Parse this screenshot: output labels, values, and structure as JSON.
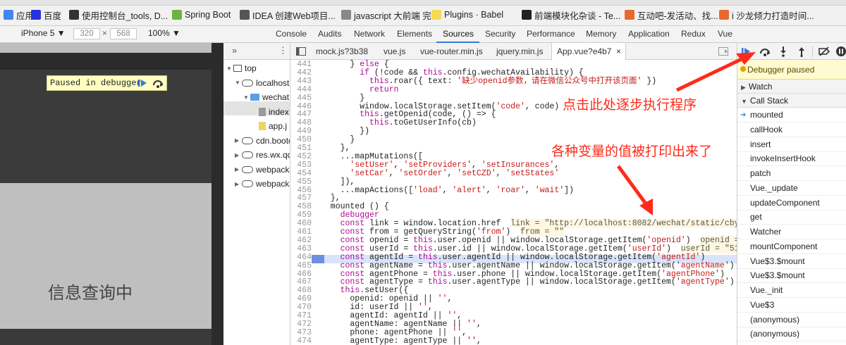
{
  "bookmarks": [
    {
      "label": "应用",
      "icon": "apps-grid-icon",
      "color": "#4285f4"
    },
    {
      "label": "百度",
      "icon": "baidu-paw-icon",
      "color": "#2932e1"
    },
    {
      "label": "使用控制台_tools, D...",
      "icon": "site-icon",
      "color": "#333333"
    },
    {
      "label": "Spring Boot",
      "icon": "spring-leaf-icon",
      "color": "#6db33f"
    },
    {
      "label": "IDEA 创建Web项目...",
      "icon": "idea-icon",
      "color": "#555555"
    },
    {
      "label": "javascript 大前端 完...",
      "icon": "page-icon",
      "color": "#888888"
    },
    {
      "label": "Plugins · Babel",
      "icon": "babel-icon",
      "color": "#f5da55"
    },
    {
      "label": "前端模块化杂谈 - Te...",
      "icon": "t-logo-icon",
      "color": "#222222"
    },
    {
      "label": "互动吧-发活动、找...",
      "icon": "hudongba-icon",
      "color": "#e8692e"
    },
    {
      "label": "i 沙龙倾力打造时间...",
      "icon": "salon-icon",
      "color": "#e8692e"
    }
  ],
  "device_toolbar": {
    "device": "iPhone 5 ▼",
    "width": "320",
    "times": "×",
    "height": "568",
    "zoom": "100% ▼"
  },
  "devtools_tabs": [
    "Console",
    "Audits",
    "Network",
    "Elements",
    "Sources",
    "Security",
    "Performance",
    "Memory",
    "Application",
    "Redux",
    "Vue"
  ],
  "active_tab": "Sources",
  "device_preview": {
    "paused_label": "Paused in debugger",
    "content_text": "信息查询中"
  },
  "file_tree": [
    {
      "label": "top",
      "depth": 0,
      "kind": "frame",
      "expanded": true
    },
    {
      "label": "localhost:",
      "depth": 1,
      "kind": "cloud",
      "expanded": true
    },
    {
      "label": "wechat",
      "depth": 2,
      "kind": "folder",
      "expanded": true
    },
    {
      "label": "index",
      "depth": 3,
      "kind": "file-gray",
      "selected": true
    },
    {
      "label": "app.j",
      "depth": 3,
      "kind": "file"
    },
    {
      "label": "cdn.bootc",
      "depth": 1,
      "kind": "cloud",
      "expanded": false
    },
    {
      "label": "res.wx.qq",
      "depth": 1,
      "kind": "cloud",
      "expanded": false
    },
    {
      "label": "webpack-",
      "depth": 1,
      "kind": "cloud",
      "expanded": false
    },
    {
      "label": "webpack:",
      "depth": 1,
      "kind": "cloud",
      "expanded": false
    }
  ],
  "file_tabs": [
    {
      "label": "mock.js?3b38",
      "active": false
    },
    {
      "label": "vue.js",
      "active": false
    },
    {
      "label": "vue-router.min.js",
      "active": false
    },
    {
      "label": "jquery.min.js",
      "active": false
    },
    {
      "label": "App.vue?e4b7",
      "active": true
    }
  ],
  "code_lines": [
    {
      "n": "441",
      "t": "      } else {"
    },
    {
      "n": "442",
      "t": "        if (!code && this.config.wechatAvailability) {"
    },
    {
      "n": "443",
      "t": "          this.roar({ text: '缺少openid参数，请在微信公众号中打开该页面' })"
    },
    {
      "n": "444",
      "t": "          return"
    },
    {
      "n": "445",
      "t": "        }"
    },
    {
      "n": "446",
      "t": "        window.localStorage.setItem('code', code)"
    },
    {
      "n": "447",
      "t": "        this.getOpenid(code, () => {"
    },
    {
      "n": "448",
      "t": "          this.toGetUserInfo(cb)"
    },
    {
      "n": "449",
      "t": "        })"
    },
    {
      "n": "450",
      "t": "      }"
    },
    {
      "n": "451",
      "t": "    },"
    },
    {
      "n": "452",
      "t": "    ...mapMutations(["
    },
    {
      "n": "453",
      "t": "      'setUser', 'setProviders', 'setInsurances',"
    },
    {
      "n": "454",
      "t": "      'setCar', 'setOrder', 'setCZD', 'setStates'"
    },
    {
      "n": "455",
      "t": "    ]),"
    },
    {
      "n": "456",
      "t": "    ...mapActions(['load', 'alert', 'roar', 'wait'])"
    },
    {
      "n": "457",
      "t": "  },"
    },
    {
      "n": "458",
      "t": "  mounted () {"
    },
    {
      "n": "459",
      "t": "    debugger"
    },
    {
      "n": "460",
      "t": "    const link = window.location.href",
      "inline": "link = \"http://localhost:8082/wechat/static/cby/dist/in"
    },
    {
      "n": "461",
      "t": "    const from = getQueryString('from')",
      "inline": "from = \"\""
    },
    {
      "n": "462",
      "t": "    const openid = this.user.openid || window.localStorage.getItem('openid')",
      "inline": "openid = \"o2PaMs"
    },
    {
      "n": "463",
      "t": "    const userId = this.user.id || window.localStorage.getItem('userId')",
      "inline": "userId = \"518b8c2b2e"
    },
    {
      "n": "464",
      "t": "    const agentId = this.user.agentId || window.localStorage.getItem('agentId')"
    },
    {
      "n": "465",
      "t": "    const agentName = this.user.agentName || window.localStorage.getItem('agentName')"
    },
    {
      "n": "466",
      "t": "    const agentPhone = this.user.phone || window.localStorage.getItem('agentPhone')"
    },
    {
      "n": "467",
      "t": "    const agentType = this.user.agentType || window.localStorage.getItem('agentType')"
    },
    {
      "n": "468",
      "t": "    this.setUser({"
    },
    {
      "n": "469",
      "t": "      openid: openid || '',"
    },
    {
      "n": "470",
      "t": "      id: userId || '',"
    },
    {
      "n": "471",
      "t": "      agentId: agentId || '',"
    },
    {
      "n": "472",
      "t": "      agentName: agentName || '',"
    },
    {
      "n": "473",
      "t": "      phone: agentPhone || '',"
    },
    {
      "n": "474",
      "t": "      agentType: agentType || '',"
    }
  ],
  "debugger": {
    "paused_banner": "Debugger paused",
    "watch_label": "Watch",
    "callstack_label": "Call Stack",
    "call_stack": [
      "mounted",
      "callHook",
      "insert",
      "invokeInsertHook",
      "patch",
      "Vue._update",
      "updateComponent",
      "get",
      "Watcher",
      "mountComponent",
      "Vue$3.$mount",
      "Vue$3.$mount",
      "Vue._init",
      "Vue$3",
      "(anonymous)",
      "(anonymous)"
    ]
  },
  "annotations": {
    "step_hint": "点击此处逐步执行程序",
    "values_hint": "各种变量的值被打印出来了",
    "color": "#ff2a1a"
  }
}
